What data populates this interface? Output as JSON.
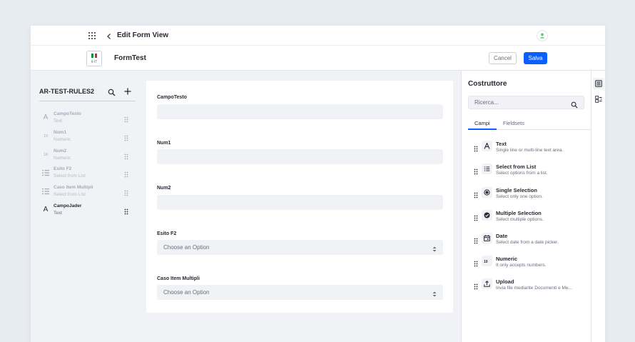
{
  "topbar": {
    "title": "Edit Form View"
  },
  "form": {
    "name": "FormTest",
    "locale": "it-IT"
  },
  "actions": {
    "cancel_label": "Cancel",
    "save_label": "Salva"
  },
  "left_panel": {
    "title": "AR-TEST-RULES2",
    "fields": [
      {
        "name": "CampoTesto",
        "type": "Text",
        "icon": "text-icon",
        "glyph": "A"
      },
      {
        "name": "Num1",
        "type": "Numeric",
        "icon": "numeric-icon",
        "glyph": "10"
      },
      {
        "name": "Num2",
        "type": "Numeric",
        "icon": "numeric-icon",
        "glyph": "10"
      },
      {
        "name": "Esito F2",
        "type": "Select from List",
        "icon": "list-icon",
        "glyph": ""
      },
      {
        "name": "Caso Item Multipli",
        "type": "Select from List",
        "icon": "list-icon",
        "glyph": ""
      },
      {
        "name": "CampoJader",
        "type": "Text",
        "icon": "text-icon",
        "glyph": "A"
      }
    ]
  },
  "canvas": {
    "fields": [
      {
        "label": "CampoTesto",
        "kind": "text",
        "placeholder": ""
      },
      {
        "label": "Num1",
        "kind": "text",
        "placeholder": ""
      },
      {
        "label": "Num2",
        "kind": "text",
        "placeholder": ""
      },
      {
        "label": "Esito F2",
        "kind": "select",
        "placeholder": "Choose an Option"
      },
      {
        "label": "Caso Item Multipli",
        "kind": "select",
        "placeholder": "Choose an Option"
      }
    ]
  },
  "builder": {
    "title": "Costruttore",
    "search_placeholder": "Ricerca...",
    "tabs": [
      "Campi",
      "Fieldsets"
    ],
    "field_types": [
      {
        "name": "Text",
        "desc": "Single line or multi-line text area.",
        "icon": "text-icon"
      },
      {
        "name": "Select from List",
        "desc": "Select options from a list.",
        "icon": "list-icon"
      },
      {
        "name": "Single Selection",
        "desc": "Select only one option.",
        "icon": "radio-icon"
      },
      {
        "name": "Multiple Selection",
        "desc": "Select multiple options.",
        "icon": "checkbox-icon"
      },
      {
        "name": "Date",
        "desc": "Select date from a date picker.",
        "icon": "calendar-icon"
      },
      {
        "name": "Numeric",
        "desc": "It only accepts numbers.",
        "icon": "numeric-icon"
      },
      {
        "name": "Upload",
        "desc": "Invia file mediante Documenti e Me...",
        "icon": "upload-icon"
      }
    ]
  },
  "colors": {
    "primary": "#0b5fff",
    "user_green": "#5aca75",
    "flag_green": "#009246",
    "flag_red": "#ce2b37"
  }
}
